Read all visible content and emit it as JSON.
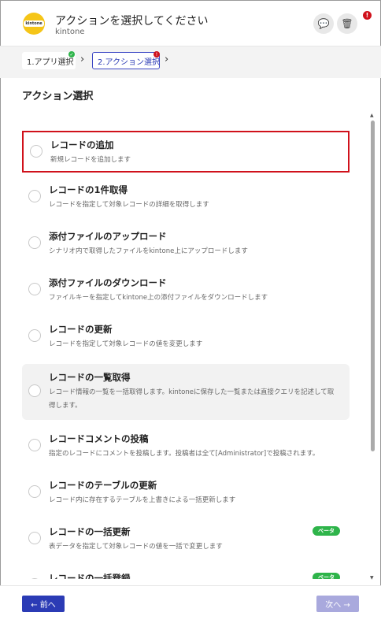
{
  "header": {
    "app_logo_text": "kintone",
    "title": "アクションを選択してください",
    "subtitle": "kintone",
    "icons": [
      "chat-icon",
      "trash-icon",
      "alert-icon"
    ],
    "alert_mark": "!"
  },
  "steps": [
    {
      "label": "1.アプリ選択",
      "status": "complete"
    },
    {
      "label": "2.アクション選択",
      "status": "current"
    }
  ],
  "section_title": "アクション選択",
  "actions": [
    {
      "title": "レコードの追加",
      "desc": "新規レコードを追加します",
      "selected": true
    },
    {
      "title": "レコードの1件取得",
      "desc": "レコードを指定して対象レコードの詳細を取得します"
    },
    {
      "title": "添付ファイルのアップロード",
      "desc": "シナリオ内で取得したファイルをkintone上にアップロードします"
    },
    {
      "title": "添付ファイルのダウンロード",
      "desc": "ファイルキーを指定してkintone上の添付ファイルをダウンロードします"
    },
    {
      "title": "レコードの更新",
      "desc": "レコードを指定して対象レコードの値を変更します"
    },
    {
      "title": "レコードの一覧取得",
      "desc": "レコード情報の一覧を一括取得します。kintoneに保存した一覧または直接クエリを記述して取得します。",
      "hover": true
    },
    {
      "title": "レコードコメントの投稿",
      "desc": "指定のレコードにコメントを投稿します。投稿者は全て[Administrator]で投稿されます。"
    },
    {
      "title": "レコードのテーブルの更新",
      "desc": "レコード内に存在するテーブルを上書きによる一括更新します"
    },
    {
      "title": "レコードの一括更新",
      "desc": "表データを指定して対象レコードの値を一括で変更します",
      "badge": "ベータ"
    },
    {
      "title": "レコードの一括登録",
      "desc": "",
      "badge": "ベータ"
    }
  ],
  "footer": {
    "prev_label": "← 前へ",
    "next_label": "次へ →"
  },
  "colors": {
    "accent": "#2b3bb5",
    "selected_border": "#d0111b",
    "beta_badge": "#2eb44a"
  }
}
